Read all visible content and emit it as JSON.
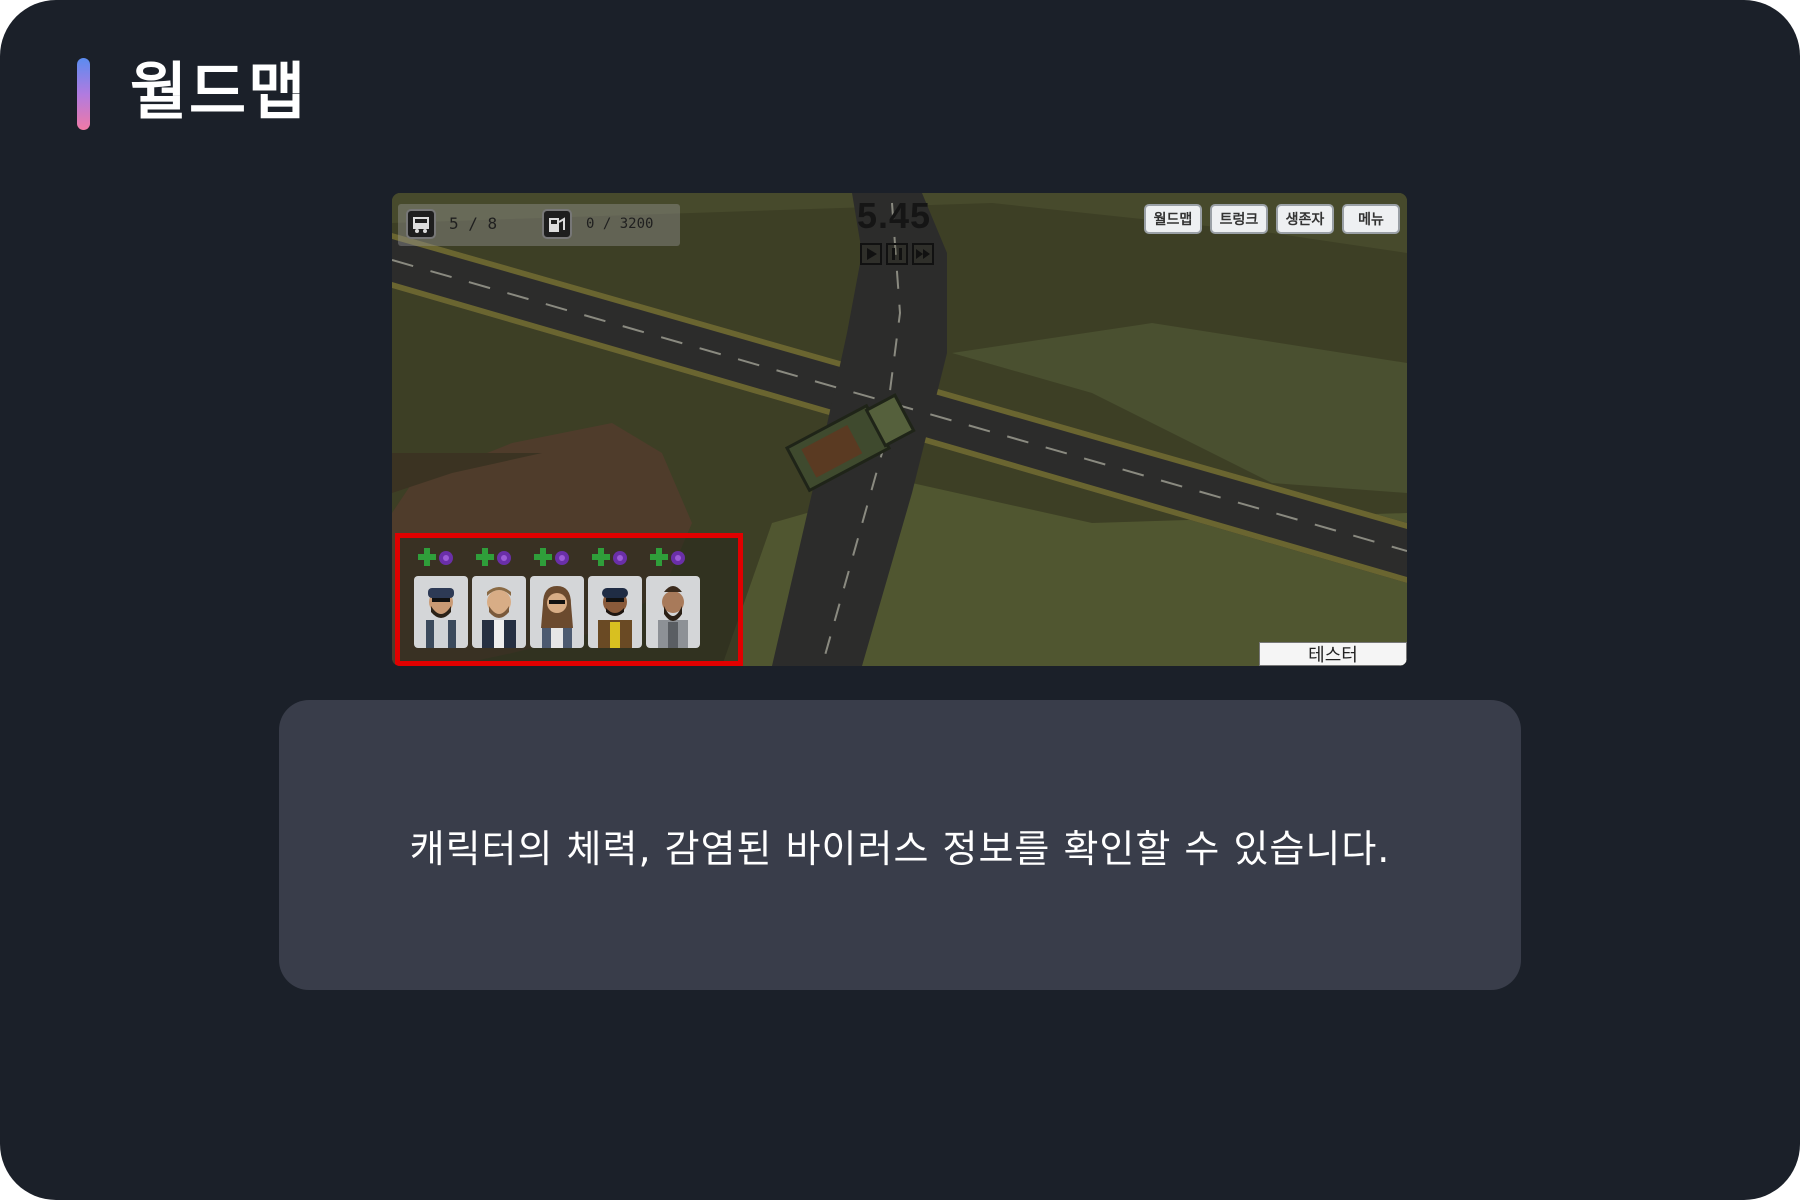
{
  "page": {
    "title": "월드맵",
    "accent_gradient": [
      "#5b8cf0",
      "#b07be0",
      "#f07aa6"
    ],
    "background": "#1b2029"
  },
  "game": {
    "hud": {
      "passengers": {
        "icon": "bus-icon",
        "value": "5 / 8"
      },
      "fuel": {
        "icon": "fuel-gauge-icon",
        "value": "0 / 3200"
      }
    },
    "timer": "5.45",
    "speed_controls": [
      {
        "name": "play",
        "icon": "play-icon"
      },
      {
        "name": "pause",
        "icon": "pause-icon"
      },
      {
        "name": "fast-forward",
        "icon": "fast-forward-icon"
      }
    ],
    "menu_buttons": [
      {
        "id": "worldmap",
        "label": "월드맵"
      },
      {
        "id": "trunk",
        "label": "트렁크"
      },
      {
        "id": "survivors",
        "label": "생존자"
      },
      {
        "id": "menu",
        "label": "메뉴"
      }
    ],
    "tester_label": "테스터",
    "highlight_color": "#e10000",
    "characters": [
      {
        "id": "survivor-1",
        "health_icon": "health-cross-icon",
        "virus_icon": "virus-icon"
      },
      {
        "id": "survivor-2",
        "health_icon": "health-cross-icon",
        "virus_icon": "virus-icon"
      },
      {
        "id": "survivor-3",
        "health_icon": "health-cross-icon",
        "virus_icon": "virus-icon"
      },
      {
        "id": "survivor-4",
        "health_icon": "health-cross-icon",
        "virus_icon": "virus-icon"
      },
      {
        "id": "survivor-5",
        "health_icon": "health-cross-icon",
        "virus_icon": "virus-icon"
      }
    ]
  },
  "caption": "캐릭터의 체력, 감염된 바이러스 정보를 확인할 수 있습니다."
}
